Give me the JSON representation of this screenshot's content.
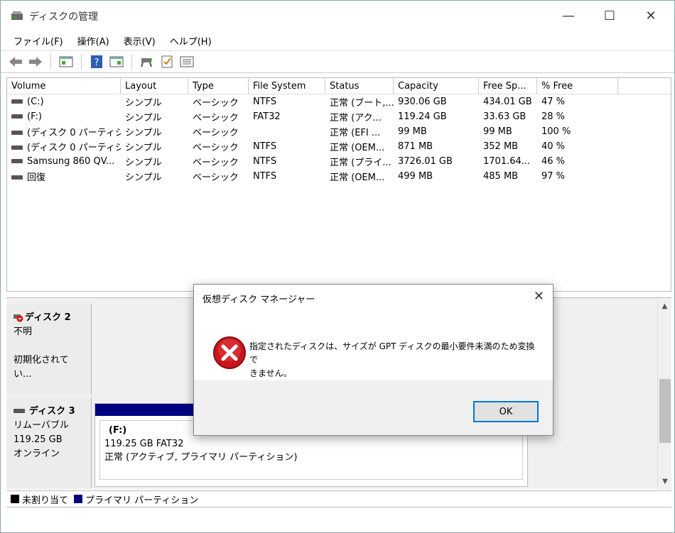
{
  "window": {
    "title": "ディスクの管理",
    "minimize_glyph": "—",
    "maximize_glyph": "☐",
    "close_glyph": "✕"
  },
  "menu": [
    "ファイル(F)",
    "操作(A)",
    "表示(V)",
    "ヘルプ(H)"
  ],
  "toolbar_icons": [
    "back-arrow-icon",
    "forward-arrow-icon",
    "pane-icon",
    "help-icon",
    "properties-icon",
    "connect-icon",
    "check-icon",
    "list-icon"
  ],
  "volume_columns": [
    "Volume",
    "Layout",
    "Type",
    "File System",
    "Status",
    "Capacity",
    "Free Sp...",
    "% Free"
  ],
  "volumes": [
    [
      "(C:)",
      "シンプル",
      "ベーシック",
      "NTFS",
      "正常 (ブート,...",
      "930.06 GB",
      "434.01 GB",
      "47 %"
    ],
    [
      "(F:)",
      "シンプル",
      "ベーシック",
      "FAT32",
      "正常 (アク...",
      "119.24 GB",
      "33.63 GB",
      "28 %"
    ],
    [
      "(ディスク 0 パーティショ...",
      "シンプル",
      "ベーシック",
      "",
      "正常 (EFI ...",
      "99 MB",
      "99 MB",
      "100 %"
    ],
    [
      "(ディスク 0 パーティショ...",
      "シンプル",
      "ベーシック",
      "NTFS",
      "正常 (OEM...",
      "871 MB",
      "352 MB",
      "40 %"
    ],
    [
      "Samsung 860 QV...",
      "シンプル",
      "ベーシック",
      "NTFS",
      "正常 (プライ...",
      "3726.01 GB",
      "1701.64...",
      "46 %"
    ],
    [
      "回復",
      "シンプル",
      "ベーシック",
      "NTFS",
      "正常 (OEM...",
      "499 MB",
      "485 MB",
      "97 %"
    ]
  ],
  "disk2": {
    "name": "ディスク 2",
    "type": "不明",
    "state": "初期化されてい..."
  },
  "disk3": {
    "name": "ディスク 3",
    "type": "リムーバブル",
    "size": "119.25 GB",
    "state": "オンライン",
    "partition": {
      "label": "(F:)",
      "size": "119.25 GB FAT32",
      "status": "正常 (アクティブ, プライマリ パーティション)"
    }
  },
  "legend": [
    {
      "label": "未割り当て",
      "color": "#000000"
    },
    {
      "label": "プライマリ パーティション",
      "color": "#000080"
    }
  ],
  "dialog": {
    "title": "仮想ディスク マネージャー",
    "message_line1": "指定されたディスクは、サイズが GPT ディスクの最小要件未満のため変換で",
    "message_line2": "きません。",
    "ok_label": "OK",
    "close_glyph": "✕"
  },
  "colors": {
    "accent": "#0078d7",
    "primary_partition": "#000080",
    "error_red": "#d11"
  }
}
